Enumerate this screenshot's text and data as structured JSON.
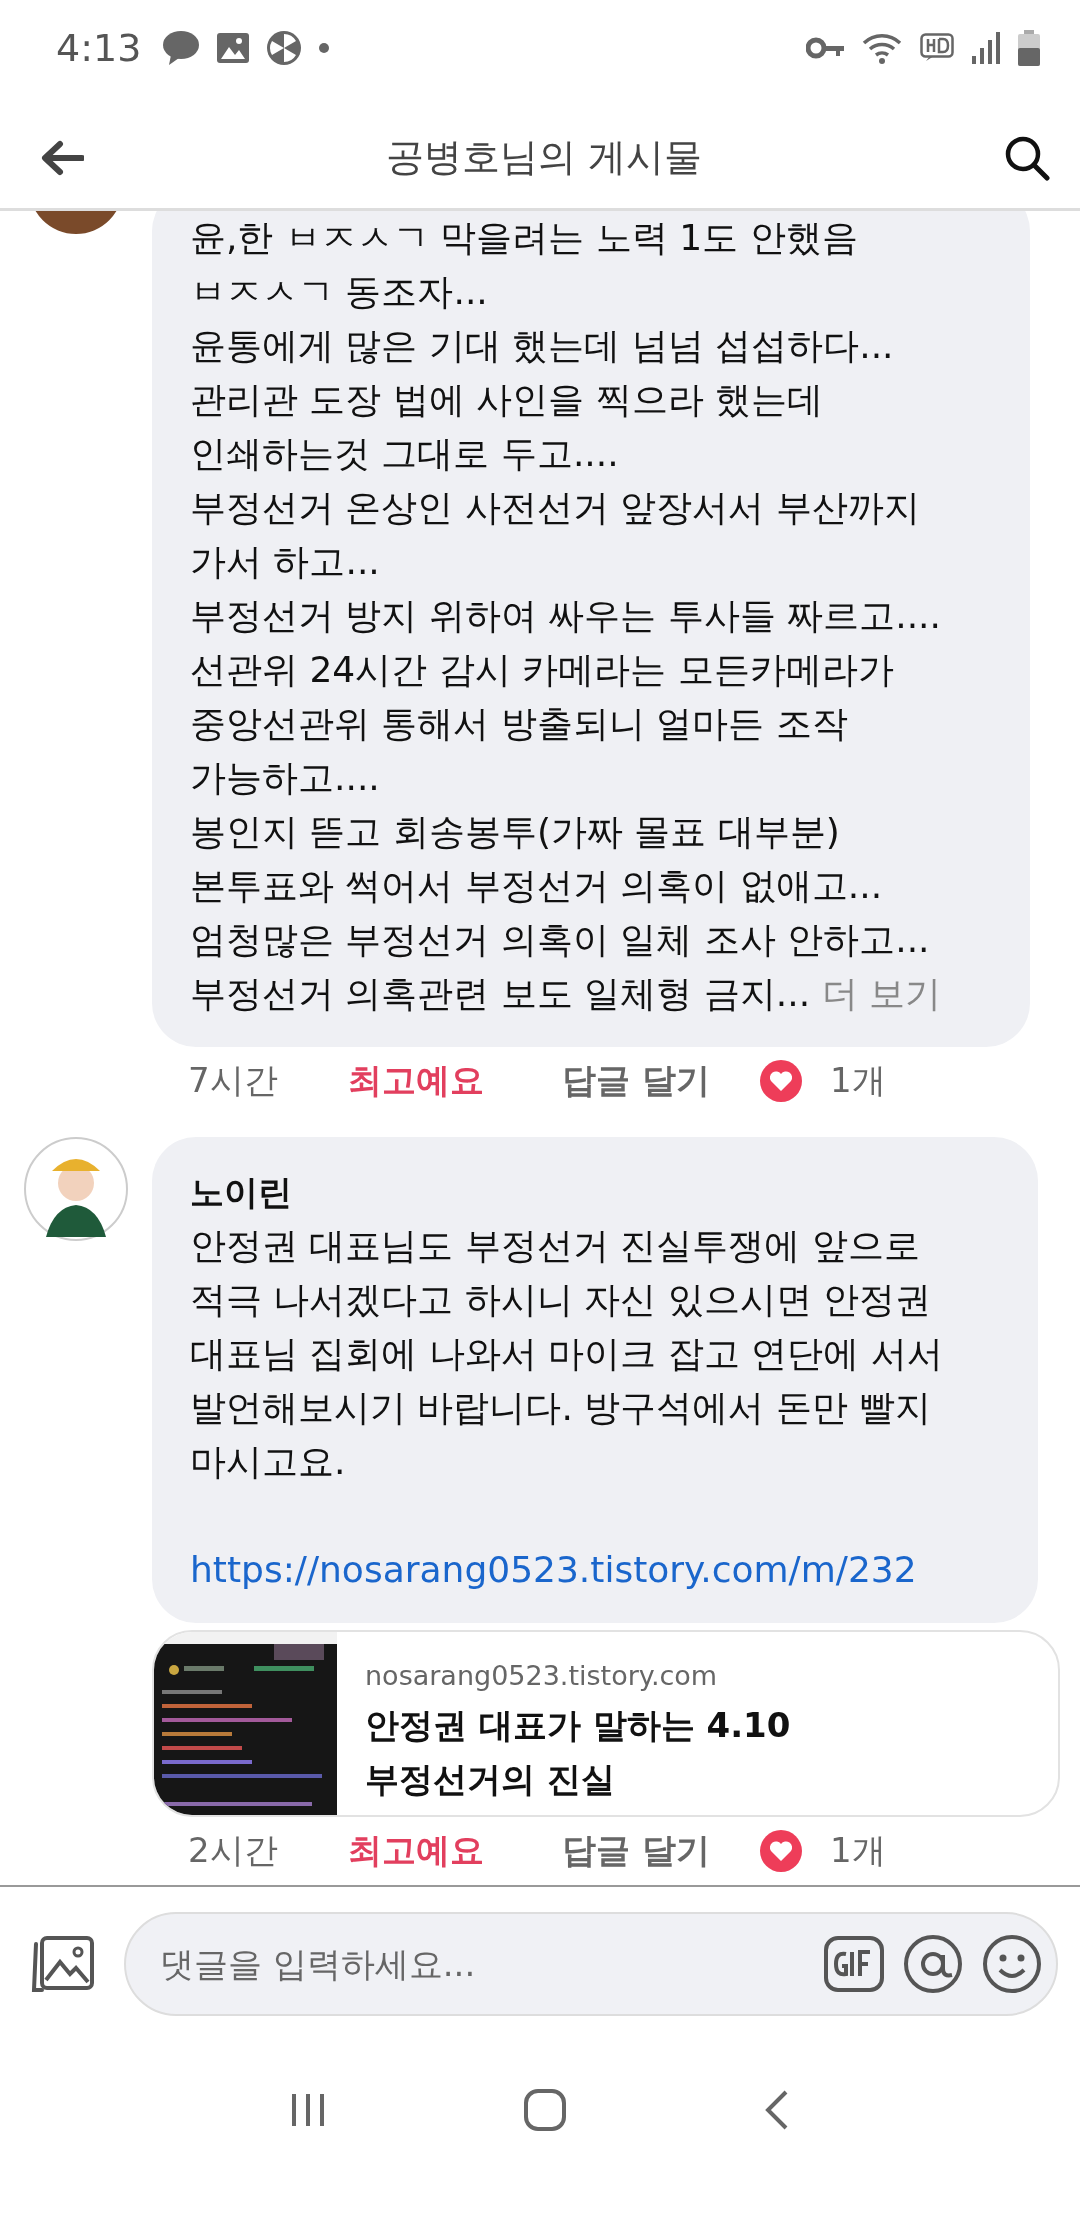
{
  "status_bar": {
    "time": "4:13"
  },
  "header": {
    "title": "공병호님의 게시물"
  },
  "comments": [
    {
      "text": "윤,한 ㅂㅈㅅㄱ 막을려는 노력 1도 안했음\nㅂㅈㅅㄱ 동조자...\n윤통에게 많은 기대 했는데 넘넘 섭섭하다...\n관리관 도장 법에 사인을 찍으라 했는데\n인쇄하는것 그대로 두고....\n부정선거 온상인 사전선거 앞장서서 부산까지\n가서 하고...\n부정선거 방지 위하여 싸우는 투사들 짜르고....\n선관위 24시간 감시 카메라는 모든카메라가\n중앙선관위 통해서 방출되니 얼마든 조작\n가능하고....\n봉인지 뜯고 회송봉투(가짜 몰표 대부분)\n본투표와 썩어서 부정선거 의혹이 없애고...\n엄청많은 부정선거 의혹이 일체 조사 안하고...\n부정선거 의혹관련 보도 일체형 금지...",
      "see_more": "더 보기",
      "time": "7시간",
      "reaction": {
        "label": "최고예요",
        "selected": true
      },
      "reply": "답글 달기",
      "reaction_count": "1개"
    },
    {
      "author": "노이린",
      "text": "안정권 대표님도 부정선거 진실투쟁에 앞으로 적극 나서겠다고 하시니 자신 있으시면 안정권 대표님 집회에 나와서 마이크 잡고 연단에 서서 발언해보시기 바랍니다. 방구석에서 돈만 빨지 마시고요.",
      "link": "https://nosarang0523.tistory.com/m/232",
      "preview": {
        "domain": "nosarang0523.tistory.com",
        "title": "안정권 대표가 말하는 4.10\n부정선거의 진실"
      },
      "time": "2시간",
      "reaction": {
        "label": "최고예요",
        "selected": true
      },
      "reply": "답글 달기",
      "reaction_count": "1개"
    }
  ],
  "composer": {
    "placeholder": "댓글을 입력하세요..."
  }
}
